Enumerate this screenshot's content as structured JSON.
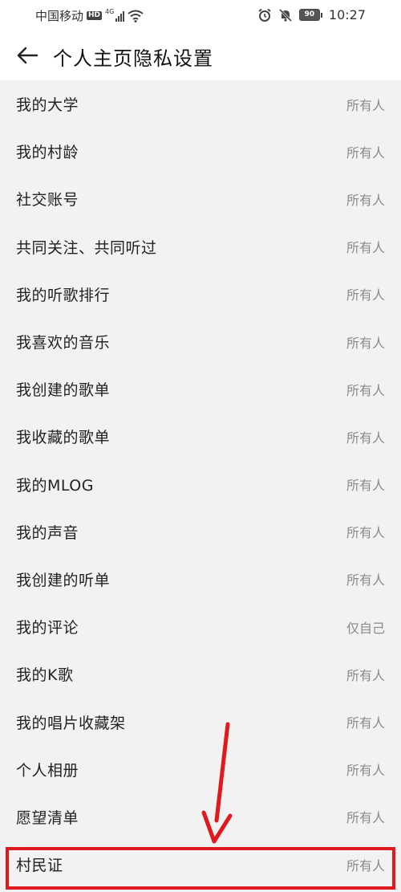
{
  "status_bar": {
    "carrier": "中国移动",
    "hd": "HD",
    "network": "4G",
    "battery": "90",
    "time": "10:27"
  },
  "header": {
    "title": "个人主页隐私设置"
  },
  "items": [
    {
      "label": "我的大学",
      "value": "所有人"
    },
    {
      "label": "我的村龄",
      "value": "所有人"
    },
    {
      "label": "社交账号",
      "value": "所有人"
    },
    {
      "label": "共同关注、共同听过",
      "value": "所有人"
    },
    {
      "label": "我的听歌排行",
      "value": "所有人"
    },
    {
      "label": "我喜欢的音乐",
      "value": "所有人"
    },
    {
      "label": "我创建的歌单",
      "value": "所有人"
    },
    {
      "label": "我收藏的歌单",
      "value": "所有人"
    },
    {
      "label": "我的MLOG",
      "value": "所有人"
    },
    {
      "label": "我的声音",
      "value": "所有人"
    },
    {
      "label": "我创建的听单",
      "value": "所有人"
    },
    {
      "label": "我的评论",
      "value": "仅自己"
    },
    {
      "label": "我的K歌",
      "value": "所有人"
    },
    {
      "label": "我的唱片收藏架",
      "value": "所有人"
    },
    {
      "label": "个人相册",
      "value": "所有人"
    },
    {
      "label": "愿望清单",
      "value": "所有人"
    },
    {
      "label": "村民证",
      "value": "所有人"
    }
  ],
  "colors": {
    "highlight": "#e0191f",
    "value_text": "#8a8a8a"
  }
}
